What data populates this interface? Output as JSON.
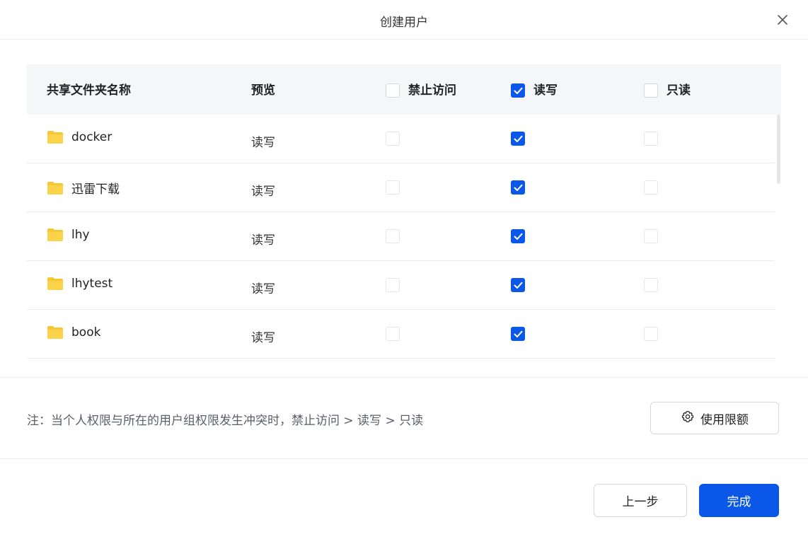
{
  "dialog": {
    "title": "创建用户"
  },
  "table": {
    "headers": {
      "name": "共享文件夹名称",
      "preview": "预览",
      "deny": "禁止访问",
      "readwrite": "读写",
      "readonly": "只读"
    },
    "header_checks": {
      "deny": false,
      "readwrite": true,
      "readonly": false
    },
    "rows": [
      {
        "name": "docker",
        "preview": "读写",
        "deny": false,
        "readwrite": true,
        "readonly": false
      },
      {
        "name": "迅雷下载",
        "preview": "读写",
        "deny": false,
        "readwrite": true,
        "readonly": false
      },
      {
        "name": "lhy",
        "preview": "读写",
        "deny": false,
        "readwrite": true,
        "readonly": false
      },
      {
        "name": "lhytest",
        "preview": "读写",
        "deny": false,
        "readwrite": true,
        "readonly": false
      },
      {
        "name": "book",
        "preview": "读写",
        "deny": false,
        "readwrite": true,
        "readonly": false
      }
    ]
  },
  "note": "注：当个人权限与所在的用户组权限发生冲突时，禁止访问 > 读写 > 只读",
  "buttons": {
    "quota": "使用限额",
    "prev": "上一步",
    "done": "完成"
  },
  "colors": {
    "accent": "#0b57e8",
    "folder": "#f7c633"
  }
}
